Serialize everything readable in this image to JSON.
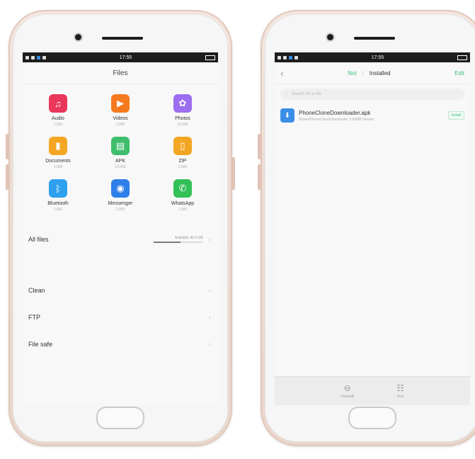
{
  "left_screen": {
    "status_time": "17:55",
    "title": "Files",
    "categories": [
      {
        "label": "Audio",
        "count": "1,000",
        "color": "#e8375b",
        "icon": "music-note-icon",
        "glyph": "♫"
      },
      {
        "label": "Videos",
        "count": "1,000",
        "color": "#f57a1f",
        "icon": "play-icon",
        "glyph": "▶"
      },
      {
        "label": "Photos",
        "count": "10,000",
        "color": "#9c6ef0",
        "icon": "photo-icon",
        "glyph": "✿"
      },
      {
        "label": "Documents",
        "count": "1,000",
        "color": "#f4a623",
        "icon": "document-icon",
        "glyph": "▮"
      },
      {
        "label": "APK",
        "count": "10,000",
        "color": "#3fbe6c",
        "icon": "apk-icon",
        "glyph": "▤"
      },
      {
        "label": "ZIP",
        "count": "1,000",
        "color": "#f2a623",
        "icon": "zip-icon",
        "glyph": "▯"
      },
      {
        "label": "Bluetooth",
        "count": "1,000",
        "color": "#2fa0ee",
        "icon": "bluetooth-icon",
        "glyph": "ᛒ"
      },
      {
        "label": "Messenger",
        "count": "1,000",
        "color": "#2f7fe8",
        "icon": "messenger-icon",
        "glyph": "◉"
      },
      {
        "label": "WhatsApp",
        "count": "1,000",
        "color": "#33c057",
        "icon": "whatsapp-icon",
        "glyph": "✆"
      }
    ],
    "all_files": {
      "label": "All files",
      "storage_text": "Available 45.3 GB",
      "used_fraction": 0.55
    },
    "menu": [
      "Clean",
      "FTP",
      "File safe"
    ]
  },
  "right_screen": {
    "status_time": "17:55",
    "tab_not": "Not",
    "tab_separator": "|",
    "tab_installed": "Installed",
    "edit": "Edit",
    "search_placeholder": "Search for a file",
    "file": {
      "name": "PhoneCloneDownloader.apk",
      "desc": "/Down/PhoneCloneDownloader  3.66MB  Version",
      "action": "Install"
    },
    "bottom": [
      {
        "label": "Uninstall",
        "icon": "uninstall-icon",
        "glyph": "⊖"
      },
      {
        "label": "Sort",
        "icon": "sort-icon",
        "glyph": "☷"
      }
    ]
  }
}
